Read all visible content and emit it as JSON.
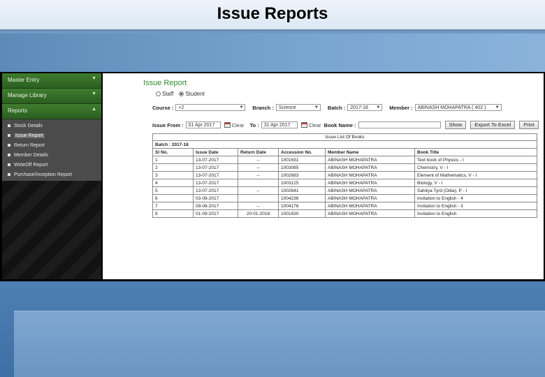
{
  "slide": {
    "title": "Issue Reports"
  },
  "sidebar": {
    "menus": [
      {
        "label": "Master Entry"
      },
      {
        "label": "Manage Library"
      },
      {
        "label": "Reports"
      }
    ],
    "report_items": [
      {
        "label": "Stock Details"
      },
      {
        "label": "Issue Report"
      },
      {
        "label": "Return Report"
      },
      {
        "label": "Member Details"
      },
      {
        "label": "WriteOff Report"
      },
      {
        "label": "Purchase/Inception Report"
      }
    ],
    "active_item": "Issue Report"
  },
  "report": {
    "title": "Issue Report",
    "radio_staff": "Staff",
    "radio_student": "Student",
    "selected_type": "Student",
    "course_label": "Course :",
    "course_value": "+2",
    "branch_label": "Branch :",
    "branch_value": "Science",
    "batch_label": "Batch :",
    "batch_value": "2017-18",
    "member_label": "Member :",
    "member_value": "ABINASH MOHAPATRA ( 402 )",
    "issue_from_label": "Issue From :",
    "issue_from_value": "01 Apr 2017",
    "clear_label": "Clear",
    "to_label": "To :",
    "to_value": "31 Apr 2017",
    "book_name_label": "Book Name :",
    "book_name_value": "",
    "show_button": "Show",
    "export_button": "Export To Excel",
    "print_button": "Print"
  },
  "table": {
    "caption": "Issue List Of Books",
    "batch_line": "Batch : 2017-18",
    "columns": [
      "Sl No.",
      "Issue Date",
      "Return Date",
      "Accession No.",
      "Member Name",
      "Book Title"
    ],
    "rows": [
      [
        "1",
        "13-07-2017",
        "--",
        "1001631",
        "ABINASH MOHAPATRA",
        "Text book of Physics - I"
      ],
      [
        "2",
        "13-07-2017",
        "--",
        "1003085",
        "ABINASH MOHAPATRA",
        "Chemistry, V - I"
      ],
      [
        "3",
        "13-07-2017",
        "--",
        "1002683",
        "ABINASH MOHAPATRA",
        "Element of Mathematics, V - I"
      ],
      [
        "4",
        "13-07-2017",
        "",
        "1003125",
        "ABINASH MOHAPATRA",
        "Biology, V - I"
      ],
      [
        "5",
        "13-07-2017",
        "--",
        "1002641",
        "ABINASH MOHAPATRA",
        "Sahitya Tyrd (Odia), P - I"
      ],
      [
        "6",
        "03-08-2017",
        "",
        "1004236",
        "ABINASH MOHAPATRA",
        "Invitation to English - 4"
      ],
      [
        "7",
        "09-08-2017",
        "--",
        "1004176",
        "ABINASH MOHAPATRA",
        "Invitation to English - 3"
      ],
      [
        "8",
        "01-09-2017",
        "20-01-2018",
        "1001830",
        "ABINASH MOHAPATRA",
        "Invitation to English"
      ]
    ]
  }
}
